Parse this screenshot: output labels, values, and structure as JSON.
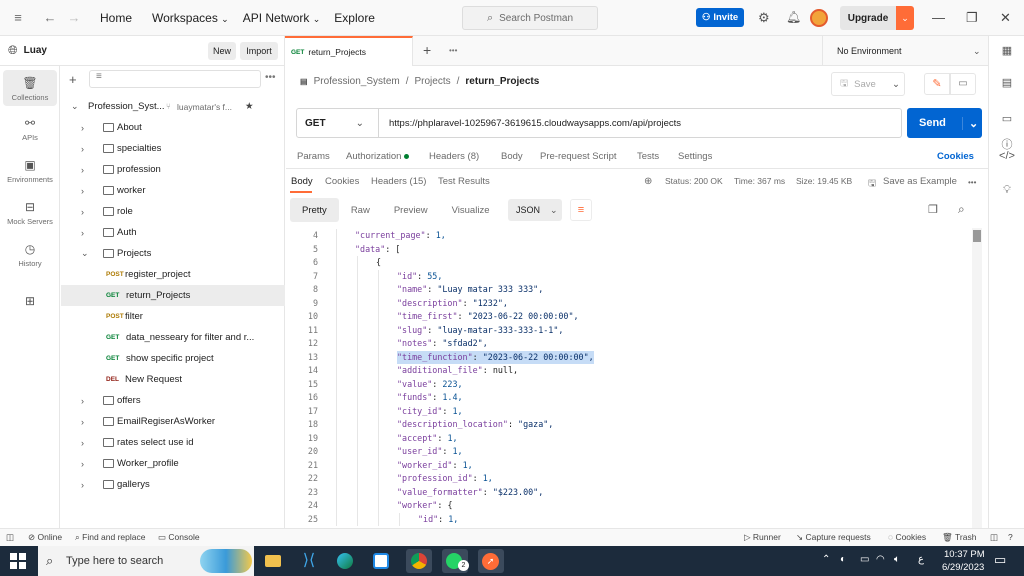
{
  "topbar": {
    "nav": [
      "Home",
      "Workspaces",
      "API Network",
      "Explore"
    ],
    "search_placeholder": "Search Postman",
    "invite": "Invite",
    "upgrade": "Upgrade"
  },
  "workspace": {
    "name": "Luay",
    "new_label": "New",
    "import_label": "Import"
  },
  "rail": [
    "Collections",
    "APIs",
    "Environments",
    "Mock Servers",
    "History"
  ],
  "tree": {
    "collection": "Profession_Syst...",
    "owner": "luaymatar's f...",
    "folders_top": [
      "About",
      "specialties",
      "profession",
      "worker",
      "role",
      "Auth",
      "Projects"
    ],
    "requests": [
      {
        "method": "POST",
        "name": "register_project"
      },
      {
        "method": "GET",
        "name": "return_Projects"
      },
      {
        "method": "POST",
        "name": "filter"
      },
      {
        "method": "GET",
        "name": "data_nesseary for filter and r..."
      },
      {
        "method": "GET",
        "name": "show specific project"
      },
      {
        "method": "DEL",
        "name": "New Request"
      }
    ],
    "folders_bottom": [
      "offers",
      "EmailRegiserAsWorker",
      "rates select use id",
      "Worker_profile",
      "gallerys"
    ]
  },
  "tab": {
    "method": "GET",
    "name": "return_Projects",
    "environment": "No Environment"
  },
  "breadcrumb": {
    "collection": "Profession_System",
    "folder": "Projects",
    "request": "return_Projects",
    "save": "Save"
  },
  "request": {
    "method": "GET",
    "url": "https://phplaravel-1025967-3619615.cloudwaysapps.com/api/projects",
    "send": "Send",
    "tabs": [
      "Params",
      "Authorization",
      "Headers (8)",
      "Body",
      "Pre-request Script",
      "Tests",
      "Settings"
    ],
    "cookies": "Cookies"
  },
  "response": {
    "tabs": [
      "Body",
      "Cookies",
      "Headers (15)",
      "Test Results"
    ],
    "status": "Status: 200 OK",
    "time": "Time: 367 ms",
    "size": "Size: 19.45 KB",
    "save_example": "Save as Example",
    "formats": [
      "Pretty",
      "Raw",
      "Preview",
      "Visualize"
    ],
    "language": "JSON"
  },
  "code": [
    {
      "n": "4",
      "indent": 1,
      "t": "\"current_page\": 1,"
    },
    {
      "n": "5",
      "indent": 1,
      "t": "\"data\": ["
    },
    {
      "n": "6",
      "indent": 2,
      "t": "{"
    },
    {
      "n": "7",
      "indent": 3,
      "t": "\"id\": 55,"
    },
    {
      "n": "8",
      "indent": 3,
      "t": "\"name\": \"Luay matar 333 333\","
    },
    {
      "n": "9",
      "indent": 3,
      "t": "\"description\": \"1232\","
    },
    {
      "n": "10",
      "indent": 3,
      "t": "\"time_first\": \"2023-06-22 00:00:00\","
    },
    {
      "n": "11",
      "indent": 3,
      "t": "\"slug\": \"luay-matar-333-333-1-1\","
    },
    {
      "n": "12",
      "indent": 3,
      "t": "\"notes\": \"sfdad2\","
    },
    {
      "n": "13",
      "indent": 3,
      "t": "\"time_function\": \"2023-06-22 00:00:00\","
    },
    {
      "n": "14",
      "indent": 3,
      "t": "\"additional_file\": null,"
    },
    {
      "n": "15",
      "indent": 3,
      "t": "\"value\": 223,"
    },
    {
      "n": "16",
      "indent": 3,
      "t": "\"funds\": 1.4,"
    },
    {
      "n": "17",
      "indent": 3,
      "t": "\"city_id\": 1,"
    },
    {
      "n": "18",
      "indent": 3,
      "t": "\"description_location\": \"gaza\","
    },
    {
      "n": "19",
      "indent": 3,
      "t": "\"accept\": 1,"
    },
    {
      "n": "20",
      "indent": 3,
      "t": "\"user_id\": 1,"
    },
    {
      "n": "21",
      "indent": 3,
      "t": "\"worker_id\": 1,"
    },
    {
      "n": "22",
      "indent": 3,
      "t": "\"profession_id\": 1,"
    },
    {
      "n": "23",
      "indent": 3,
      "t": "\"value_formatter\": \"$223.00\","
    },
    {
      "n": "24",
      "indent": 3,
      "t": "\"worker\": {"
    },
    {
      "n": "25",
      "indent": 4,
      "t": "\"id\": 1,"
    }
  ],
  "statusbar": {
    "online": "Online",
    "find": "Find and replace",
    "console": "Console",
    "runner": "Runner",
    "capture": "Capture requests",
    "cookies": "Cookies",
    "trash": "Trash"
  },
  "taskbar": {
    "search": "Type here to search",
    "time": "10:37 PM",
    "date": "6/29/2023",
    "lang": "ع",
    "badge": "2"
  },
  "colors": {
    "accent": "#ff6c37",
    "primary": "#0265d2",
    "get": "#007f31",
    "post": "#ad7a03",
    "del": "#8e1a10"
  }
}
